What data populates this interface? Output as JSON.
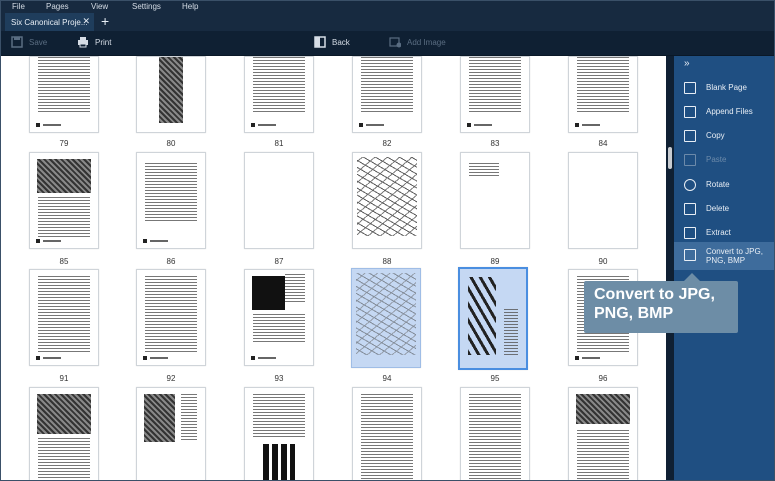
{
  "menu": [
    "File",
    "Pages",
    "View",
    "Settings",
    "Help"
  ],
  "tab": {
    "title": "Six Canonical Proje...",
    "close": "✕",
    "new": "+"
  },
  "toolbar": {
    "save": "Save",
    "print": "Print",
    "back": "Back",
    "add_image": "Add Image"
  },
  "pages": [
    {
      "num": "79"
    },
    {
      "num": "80"
    },
    {
      "num": "81"
    },
    {
      "num": "82"
    },
    {
      "num": "83"
    },
    {
      "num": "84"
    },
    {
      "num": "85"
    },
    {
      "num": "86"
    },
    {
      "num": "87"
    },
    {
      "num": "88"
    },
    {
      "num": "89"
    },
    {
      "num": "90"
    },
    {
      "num": "91"
    },
    {
      "num": "92"
    },
    {
      "num": "93"
    },
    {
      "num": "94"
    },
    {
      "num": "95"
    },
    {
      "num": "96"
    }
  ],
  "sidebar": {
    "collapse": "»",
    "items": [
      {
        "label": "Blank Page"
      },
      {
        "label": "Append Files"
      },
      {
        "label": "Copy"
      },
      {
        "label": "Paste"
      },
      {
        "label": "Rotate"
      },
      {
        "label": "Delete"
      },
      {
        "label": "Extract"
      },
      {
        "label": "Convert to JPG, PNG, BMP"
      }
    ]
  },
  "tooltip": {
    "line1": "Convert to JPG,",
    "line2": "PNG, BMP"
  },
  "colors": {
    "sidebar_bg": "#1f4f82",
    "selection": "#c5d8f3",
    "focus_border": "#4a8ee0",
    "tooltip_bg": "#6d8da6"
  }
}
